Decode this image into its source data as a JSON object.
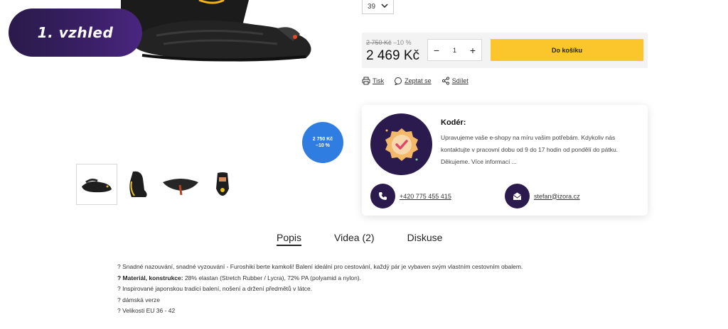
{
  "hero": {
    "badge_text": "1. vzhled"
  },
  "size_select": {
    "value": "39"
  },
  "pricing": {
    "old_price": "2 750 Kč",
    "discount": "–10 %",
    "new_price": "2 469 Kč",
    "quantity": "1",
    "minus_label": "−",
    "plus_label": "+",
    "cart_button": "Do košíku"
  },
  "actions": [
    {
      "label": "Tisk",
      "icon": "printer-icon"
    },
    {
      "label": "Zeptat se",
      "icon": "chat-icon"
    },
    {
      "label": "Sdílet",
      "icon": "share-icon"
    }
  ],
  "discount_badge": {
    "price": "2 750 Kč",
    "percent": "–10 %"
  },
  "contact": {
    "title": "Kodér:",
    "text": "Upravujeme vaše e-shopy na míru vašim potřebám. Kdykoliv nás kontaktujte v pracovní dobu od 9 do 17 hodin od pondělí do pátku. Děkujeme. Více informací ...",
    "phone": "+420 775 455 415",
    "email": "stefan@izora.cz"
  },
  "tabs": [
    {
      "label": "Popis",
      "active": true
    },
    {
      "label": "Videa (2)",
      "active": false
    },
    {
      "label": "Diskuse",
      "active": false
    }
  ],
  "description": {
    "line1": "? Snadné nazouvání, snadné vyzouvání - Furoshiki berte kamkoli! Balení ideální pro cestování, každý pár je vybaven svým vlastním cestovním obalem.",
    "line2_bold": "? Materiál, konstrukce:",
    "line2_rest": " 28% elastan (Stretch Rubber / Lycra), 72% PA (polyamid a nylon).",
    "line3": "? Inspirované japonskou tradicí balení, nošení a držení předmětů v látce.",
    "line4": "? dámská verze",
    "line5": "? Velikosti EU 36 - 42"
  },
  "colors": {
    "accent_yellow": "#fbc52c",
    "brand_purple": "#2b1a4e",
    "badge_blue": "#2f7de1"
  }
}
